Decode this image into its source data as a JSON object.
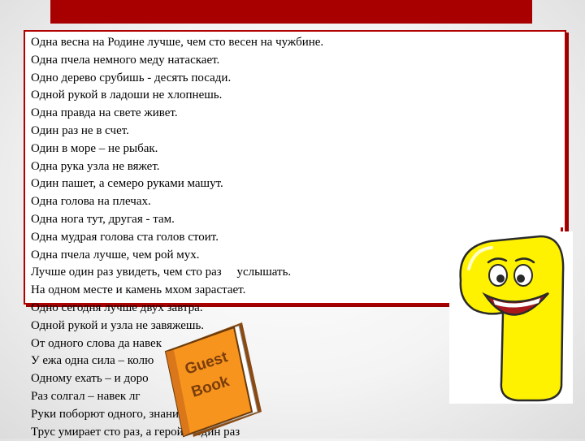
{
  "proverbs": [
    "Одна весна на Родине лучше, чем сто весен на чужбине.",
    "Одна пчела немного меду натаскает.",
    "Одно дерево срубишь - десять посади.",
    "Одной рукой в ладоши не хлопнешь.",
    "Одна правда на свете живет.",
    "Один раз не в счет.",
    "Один в море – не рыбак.",
    "Одна рука узла не вяжет.",
    "Один пашет, а семеро руками машут.",
    "Одна голова на плечах.",
    "Одна нога тут, другая - там.",
    "Одна мудрая голова ста голов стоит.",
    "Одна пчела лучше, чем рой мух.",
    "Лучше один раз увидеть, чем сто раз     услышать.",
    "На одном месте и камень мхом зарастает.",
    "Одно сегодня лучше двух завтра.",
    "Одной рукой и узла не завяжешь.",
    "От одного слова да навек",
    "У ежа одна сила – колю",
    "Одному ехать – и доро",
    "Раз солгал – навек лг",
    "Руки поборют одного, знания – тысячу.",
    "Трус умирает сто раз, а герой – один раз"
  ],
  "book": {
    "title_line1": "Guest",
    "title_line2": "Book"
  },
  "colors": {
    "accent_red": "#a80000",
    "book_orange": "#f7941d",
    "digit_yellow": "#fff200"
  }
}
